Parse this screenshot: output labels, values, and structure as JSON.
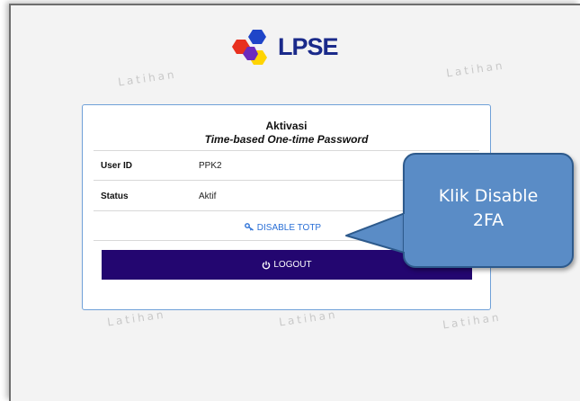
{
  "watermark": "Latihan",
  "logo": {
    "text": "LPSE"
  },
  "card": {
    "title": "Aktivasi",
    "subtitle": "Time-based One-time Password",
    "fields": [
      {
        "label": "User ID",
        "value": "PPK2"
      },
      {
        "label": "Status",
        "value": "Aktif"
      }
    ],
    "disable_label": "DISABLE TOTP",
    "logout_label": "LOGOUT"
  },
  "callout": {
    "line1": "Klik Disable",
    "line2": "2FA"
  },
  "colors": {
    "logout_bg": "#230670",
    "link": "#2a6fd6",
    "callout_bg": "#5a8cc6",
    "card_border": "#6fa0d8"
  }
}
